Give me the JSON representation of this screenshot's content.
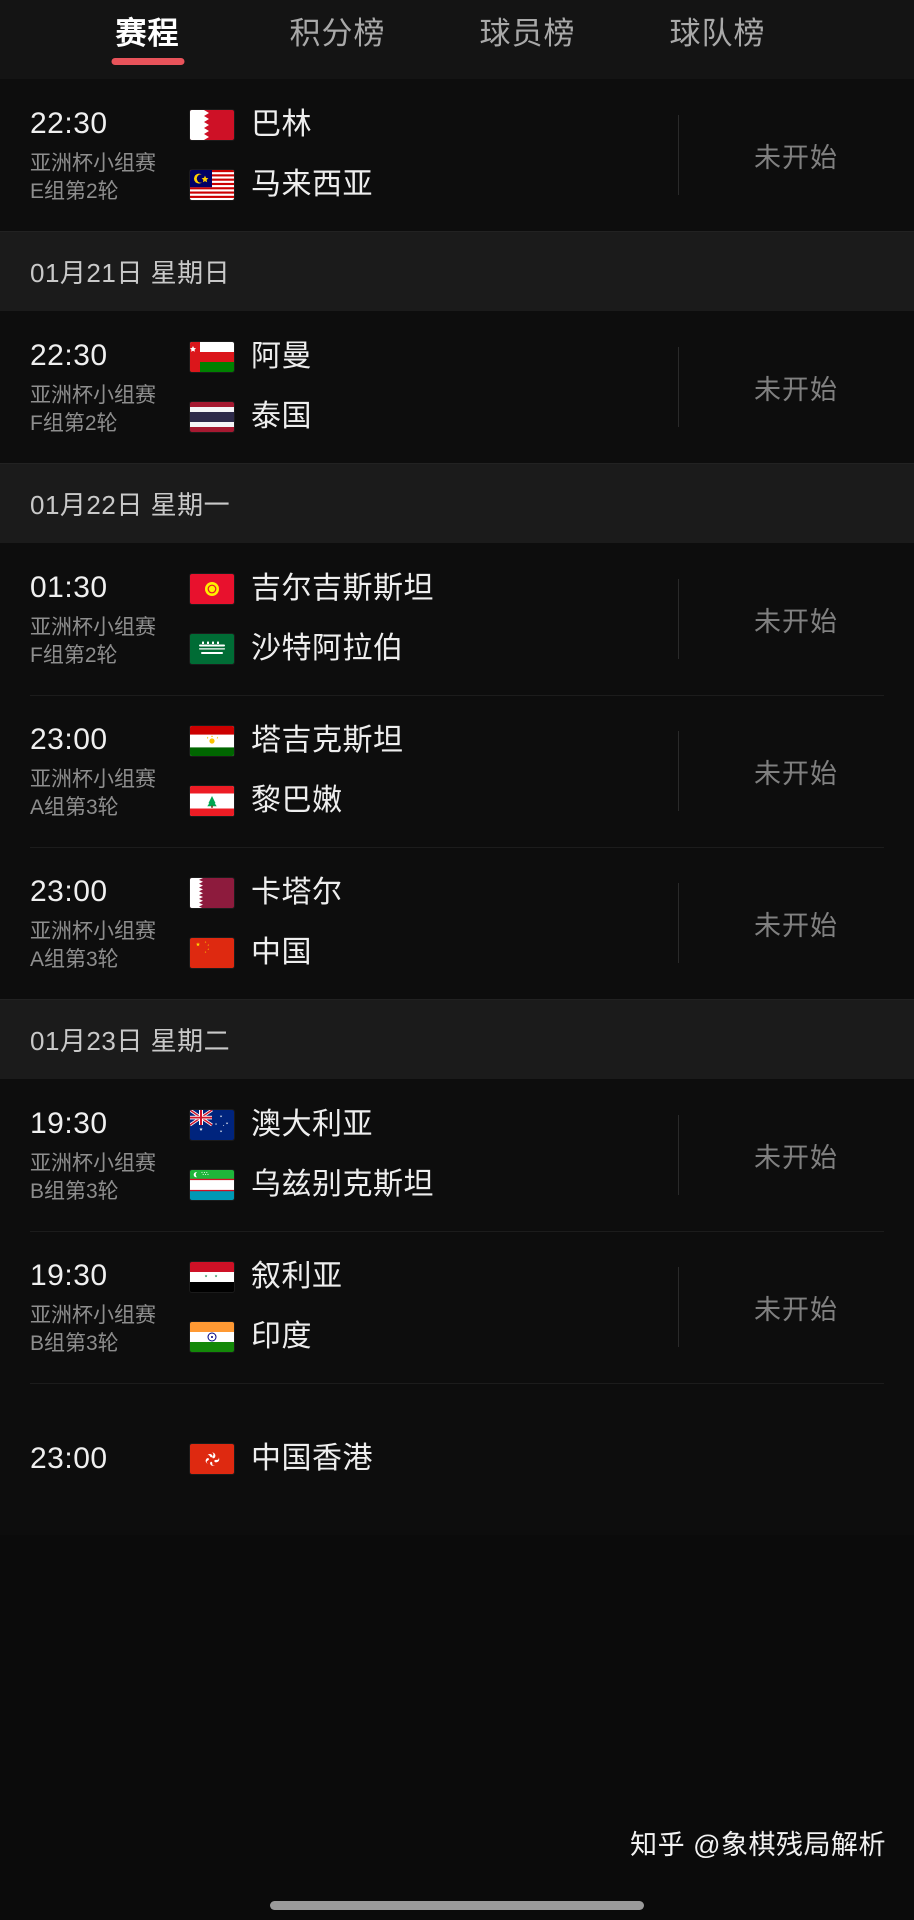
{
  "tabs": [
    {
      "label": "赛程",
      "active": true
    },
    {
      "label": "积分榜",
      "active": false
    },
    {
      "label": "球员榜",
      "active": false
    },
    {
      "label": "球队榜",
      "active": false
    }
  ],
  "status_label": "未开始",
  "watermark": "知乎 @象棋残局解析",
  "accent_color": "#e8535a",
  "sections": [
    {
      "date": null,
      "matches": [
        {
          "time": "22:30",
          "competition_line1": "亚洲杯小组赛",
          "competition_line2": "E组第2轮",
          "home": {
            "name": "巴林",
            "flag": "bh"
          },
          "away": {
            "name": "马来西亚",
            "flag": "my"
          },
          "status": "未开始"
        }
      ]
    },
    {
      "date": "01月21日 星期日",
      "matches": [
        {
          "time": "22:30",
          "competition_line1": "亚洲杯小组赛",
          "competition_line2": "F组第2轮",
          "home": {
            "name": "阿曼",
            "flag": "om"
          },
          "away": {
            "name": "泰国",
            "flag": "th"
          },
          "status": "未开始"
        }
      ]
    },
    {
      "date": "01月22日 星期一",
      "matches": [
        {
          "time": "01:30",
          "competition_line1": "亚洲杯小组赛",
          "competition_line2": "F组第2轮",
          "home": {
            "name": "吉尔吉斯斯坦",
            "flag": "kg"
          },
          "away": {
            "name": "沙特阿拉伯",
            "flag": "sa"
          },
          "status": "未开始"
        },
        {
          "time": "23:00",
          "competition_line1": "亚洲杯小组赛",
          "competition_line2": "A组第3轮",
          "home": {
            "name": "塔吉克斯坦",
            "flag": "tj"
          },
          "away": {
            "name": "黎巴嫩",
            "flag": "lb"
          },
          "status": "未开始"
        },
        {
          "time": "23:00",
          "competition_line1": "亚洲杯小组赛",
          "competition_line2": "A组第3轮",
          "home": {
            "name": "卡塔尔",
            "flag": "qa"
          },
          "away": {
            "name": "中国",
            "flag": "cn"
          },
          "status": "未开始"
        }
      ]
    },
    {
      "date": "01月23日 星期二",
      "matches": [
        {
          "time": "19:30",
          "competition_line1": "亚洲杯小组赛",
          "competition_line2": "B组第3轮",
          "home": {
            "name": "澳大利亚",
            "flag": "au"
          },
          "away": {
            "name": "乌兹别克斯坦",
            "flag": "uz"
          },
          "status": "未开始"
        },
        {
          "time": "19:30",
          "competition_line1": "亚洲杯小组赛",
          "competition_line2": "B组第3轮",
          "home": {
            "name": "叙利亚",
            "flag": "sy"
          },
          "away": {
            "name": "印度",
            "flag": "in"
          },
          "status": "未开始"
        },
        {
          "time": "23:00",
          "competition_line1": "",
          "competition_line2": "",
          "home": {
            "name": "中国香港",
            "flag": "hk"
          },
          "away": null,
          "status": ""
        }
      ]
    }
  ]
}
